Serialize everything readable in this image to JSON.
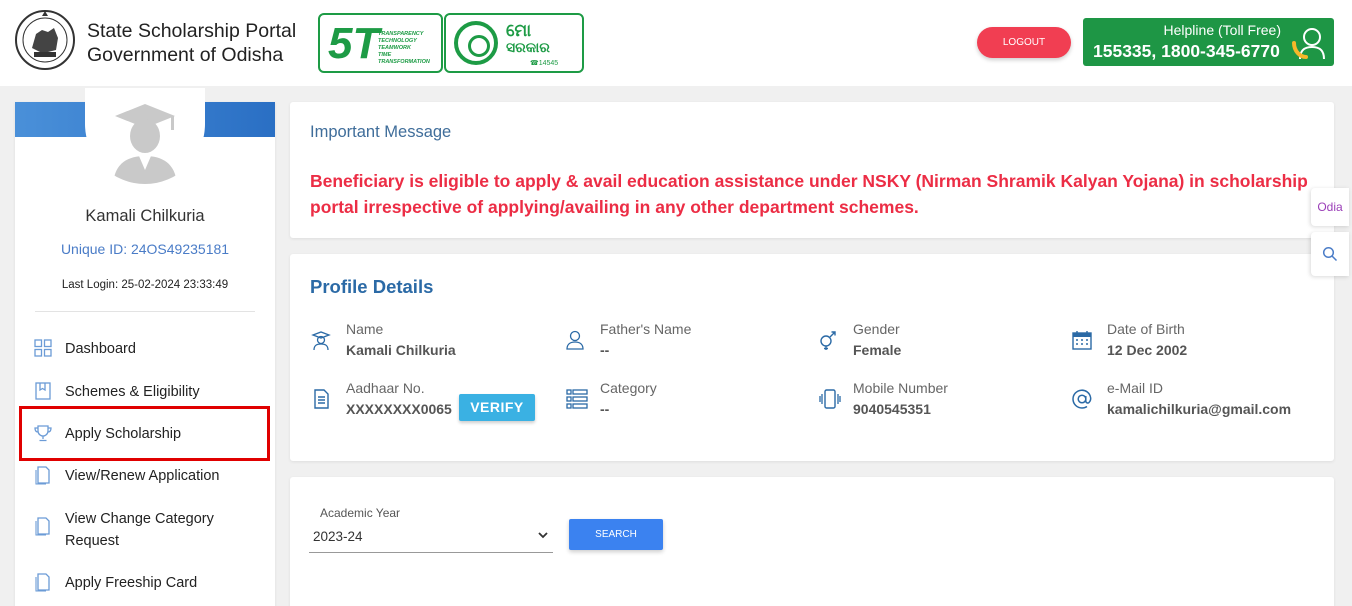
{
  "header": {
    "portal_title_line1": "State Scholarship Portal",
    "portal_title_line2": "Government of Odisha",
    "logo_5t": {
      "mark": "5T",
      "words": [
        "TRANSPARENCY",
        "TECHNOLOGY",
        "TEAMWORK",
        "TIME",
        "TRANSFORMATION"
      ]
    },
    "logo_mo_sarkar": {
      "line1": "ମୋ",
      "line2": "ସରକାର",
      "line3": "☎14545"
    },
    "logout_label": "LOGOUT",
    "helpline_label": "Helpline (Toll Free)",
    "helpline_numbers": "155335, 1800-345-6770"
  },
  "sidebar": {
    "user_name": "Kamali Chilkuria",
    "unique_id": "Unique ID: 24OS49235181",
    "last_login": "Last Login: 25-02-2024 23:33:49",
    "menu": [
      {
        "label": "Dashboard",
        "icon": "grid-icon"
      },
      {
        "label": "Schemes & Eligibility",
        "icon": "book-icon"
      },
      {
        "label": "Apply Scholarship",
        "icon": "trophy-icon"
      },
      {
        "label": "View/Renew Application",
        "icon": "document-icon"
      },
      {
        "label": "View Change Category Request",
        "icon": "document-icon"
      },
      {
        "label": "Apply Freeship Card",
        "icon": "document-icon"
      }
    ]
  },
  "message": {
    "title": "Important Message",
    "body": "Beneficiary is eligible to apply & avail education assistance under NSKY (Nirman Shramik Kalyan Yojana) in scholarship portal irrespective of applying/availing in any other department schemes."
  },
  "profile": {
    "title": "Profile Details",
    "fields": [
      {
        "label": "Name",
        "value": "Kamali Chilkuria",
        "icon": "graduate-icon"
      },
      {
        "label": "Father's Name",
        "value": "--",
        "icon": "user-icon"
      },
      {
        "label": "Gender",
        "value": "Female",
        "icon": "gender-icon"
      },
      {
        "label": "Date of Birth",
        "value": "12 Dec 2002",
        "icon": "calendar-icon"
      },
      {
        "label": "Aadhaar No.",
        "value": "XXXXXXXX0065",
        "icon": "id-card-icon"
      },
      {
        "label": "Category",
        "value": "--",
        "icon": "list-icon"
      },
      {
        "label": "Mobile Number",
        "value": "9040545351",
        "icon": "phone-vibrate-icon"
      },
      {
        "label": "e-Mail ID",
        "value": "kamalichilkuria@gmail.com",
        "icon": "at-icon"
      }
    ],
    "verify_label": "VERIFY"
  },
  "search": {
    "academic_year_label": "Academic Year",
    "academic_year_value": "2023-24",
    "search_label": "SEARCH"
  },
  "side_tabs": {
    "odia_label": "Odia"
  },
  "colors": {
    "accent_green": "#1e9645",
    "logout_red": "#f13e52",
    "message_red": "#ec2d45",
    "title_blue": "#2b6aa6",
    "search_blue": "#3b82f0",
    "verify_blue": "#3ab1e3",
    "highlight_red": "#e00000"
  }
}
